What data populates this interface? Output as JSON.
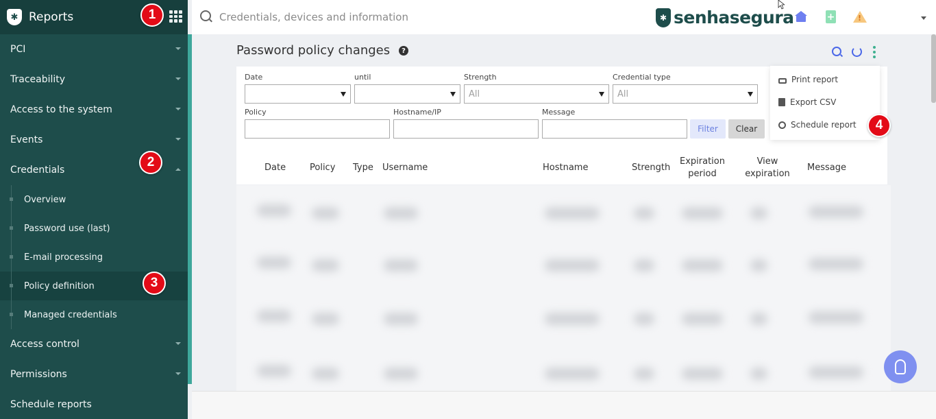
{
  "sidebar": {
    "title": "Reports",
    "items": [
      {
        "label": "PCI"
      },
      {
        "label": "Traceability"
      },
      {
        "label": "Access to the system"
      },
      {
        "label": "Events"
      },
      {
        "label": "Credentials"
      },
      {
        "label": "Access control"
      },
      {
        "label": "Permissions"
      },
      {
        "label": "Schedule reports"
      }
    ],
    "sub_items": [
      {
        "label": "Overview"
      },
      {
        "label": "Password use (last)"
      },
      {
        "label": "E-mail processing"
      },
      {
        "label": "Policy definition"
      },
      {
        "label": "Managed credentials"
      }
    ]
  },
  "topbar": {
    "search_placeholder": "Credentials, devices and information",
    "brand": "senhasegura"
  },
  "page": {
    "title": "Password policy changes",
    "filters": {
      "date_label": "Date",
      "until_label": "until",
      "strength_label": "Strength",
      "strength_value": "All",
      "credential_type_label": "Credential type",
      "credential_type_value": "All",
      "policy_label": "Policy",
      "hostname_label": "Hostname/IP",
      "message_label": "Message",
      "filter_button": "Filter",
      "clear_button": "Clear"
    },
    "columns": [
      "Date",
      "Policy",
      "Type",
      "Username",
      "Hostname",
      "Strength",
      "Expiration period",
      "View expiration",
      "Message"
    ]
  },
  "menu": {
    "items": [
      {
        "label": "Print report",
        "icon": "printer-icon"
      },
      {
        "label": "Export CSV",
        "icon": "file-icon"
      },
      {
        "label": "Schedule report",
        "icon": "clock-icon"
      }
    ]
  },
  "annotations": [
    "1",
    "2",
    "3",
    "4"
  ],
  "colors": {
    "sidebar": "#1e4d4b",
    "accent": "#4a67e8",
    "badge": "#e30b17"
  }
}
